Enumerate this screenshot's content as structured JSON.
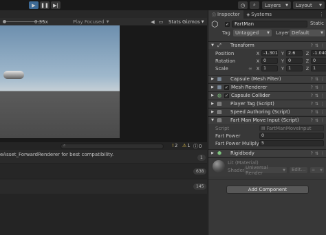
{
  "toolbar": {
    "layers_label": "Layers",
    "layout_label": "Layout"
  },
  "game_view": {
    "scale_label": "0.35x",
    "play_mode": "Play Focused",
    "stats_label": "Stats",
    "gizmos_label": "Gizmos"
  },
  "console": {
    "warning_count": "2",
    "error_count": "1",
    "info_count": "0",
    "messages": [
      {
        "text": "eAsset_ForwardRenderer for best compatibility.",
        "count": "1"
      },
      {
        "text": "",
        "count": "638"
      },
      {
        "text": "",
        "count": "145"
      }
    ]
  },
  "inspector": {
    "tabs": [
      "Inspector",
      "Systems"
    ],
    "object_name": "FartMan",
    "static_label": "Static",
    "tag_label": "Tag",
    "tag_value": "Untagged",
    "layer_label": "Layer",
    "layer_value": "Default",
    "transform": {
      "title": "Transform",
      "position_label": "Position",
      "rotation_label": "Rotation",
      "scale_label": "Scale",
      "position": {
        "x": "-1.301",
        "y": "2.6",
        "z": "-1.040"
      },
      "rotation": {
        "x": "0",
        "y": "0",
        "z": "0"
      },
      "scale": {
        "x": "1",
        "y": "1",
        "z": "1"
      }
    },
    "components": [
      "Capsule (Mesh Filter)",
      "Mesh Renderer",
      "Capsule Collider",
      "Player Tag (Script)",
      "Speed Authoring (Script)",
      "Fart Man Move Input (Script)"
    ],
    "script_label": "Script",
    "script_value": "FartManMoveInput",
    "fart_power_label": "Fart Power",
    "fart_power_value": "0",
    "fart_power_mult_label": "Fart Power Muliplyer",
    "fart_power_mult_value": "5",
    "rigidbody_title": "Rigidbody",
    "material_name": "Lit (Material)",
    "shader_label": "Shader",
    "shader_value": "Universal Render",
    "edit_label": "Edit...",
    "add_component_label": "Add Component"
  }
}
